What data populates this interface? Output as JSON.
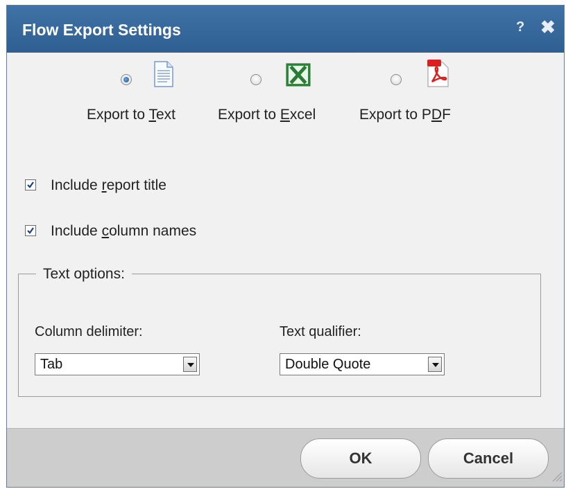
{
  "dialog": {
    "title": "Flow Export Settings",
    "help_label": "?",
    "close_label": "✖"
  },
  "export_options": [
    {
      "label_before": "Export to ",
      "accel": "T",
      "label_after": "ext",
      "icon": "text-document-icon",
      "selected": true
    },
    {
      "label_before": "Export to ",
      "accel": "E",
      "label_after": "xcel",
      "icon": "excel-icon",
      "selected": false
    },
    {
      "label_before": "Export to P",
      "accel": "D",
      "label_after": "F",
      "icon": "pdf-icon",
      "selected": false
    }
  ],
  "checkboxes": [
    {
      "label_before": "Include ",
      "accel": "r",
      "label_after": "eport title",
      "checked": true
    },
    {
      "label_before": "Include ",
      "accel": "c",
      "label_after": "olumn names",
      "checked": true
    }
  ],
  "text_options": {
    "legend": "Text options:",
    "column_delimiter": {
      "label": "Column delimiter:",
      "value": "Tab"
    },
    "text_qualifier": {
      "label": "Text qualifier:",
      "value": "Double Quote"
    }
  },
  "buttons": {
    "ok": "OK",
    "cancel": "Cancel"
  },
  "colors": {
    "titlebar": "#2f5f92",
    "body": "#f1f1f1",
    "footer": "#cdcdcd"
  }
}
